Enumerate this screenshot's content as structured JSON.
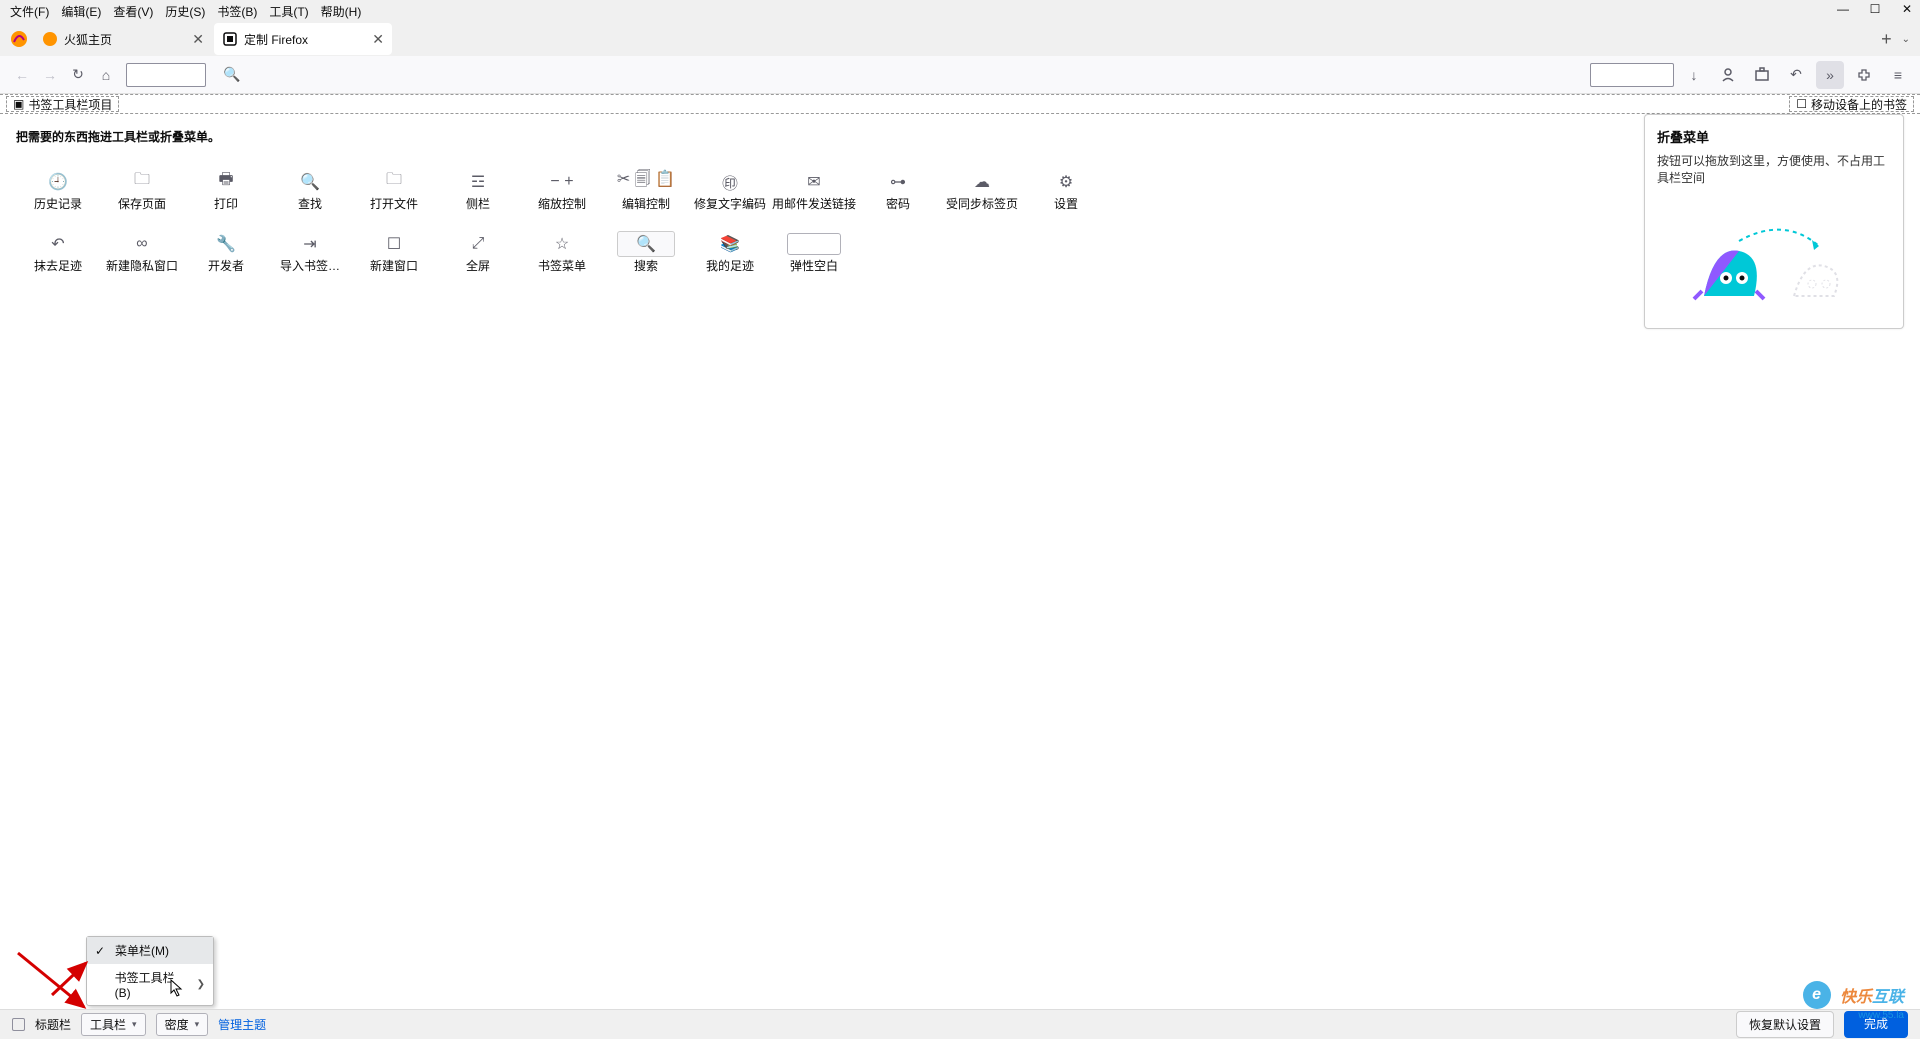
{
  "menu": {
    "file": "文件(F)",
    "edit": "编辑(E)",
    "view": "查看(V)",
    "history": "历史(S)",
    "bookmarks": "书签(B)",
    "tools": "工具(T)",
    "help": "帮助(H)"
  },
  "win": {
    "min": "—",
    "max": "☐",
    "close": "✕"
  },
  "tabs": {
    "t1": {
      "title": "火狐主页"
    },
    "t2": {
      "title": "定制 Firefox"
    },
    "plus": "+",
    "caret": "⌄"
  },
  "nav": {
    "back": "←",
    "forward": "→",
    "reload": "↻",
    "home": "⌂",
    "download": "↓",
    "account": "◯",
    "screenshot": "⧉",
    "forget": "↶",
    "more": "»",
    "ext": "✧",
    "hamburger": "≡"
  },
  "bm": {
    "left_icon": "▣",
    "left": "书签工具栏项目",
    "right_icon": "☐",
    "right": "移动设备上的书签"
  },
  "customize": {
    "instruction": "把需要的东西拖进工具栏或折叠菜单。",
    "tools": [
      {
        "label": "历史记录",
        "icon": "🕘"
      },
      {
        "label": "保存页面",
        "icon": "🗀"
      },
      {
        "label": "打印",
        "icon": "🖶"
      },
      {
        "label": "查找",
        "icon": "🔍"
      },
      {
        "label": "打开文件",
        "icon": "🗀"
      },
      {
        "label": "侧栏",
        "icon": "☲"
      },
      {
        "label": "缩放控制",
        "icon": "− +"
      },
      {
        "label": "编辑控制",
        "icon": "✂ 🗐 📋"
      },
      {
        "label": "修复文字编码",
        "icon": "㊞"
      },
      {
        "label": "用邮件发送链接",
        "icon": "✉"
      },
      {
        "label": "密码",
        "icon": "⊶"
      },
      {
        "label": "受同步标签页",
        "icon": "☁"
      },
      {
        "label": "设置",
        "icon": "⚙"
      },
      {
        "label": "抹去足迹",
        "icon": "↶"
      },
      {
        "label": "新建隐私窗口",
        "icon": "∞"
      },
      {
        "label": "开发者",
        "icon": "🔧"
      },
      {
        "label": "导入书签…",
        "icon": "⇥"
      },
      {
        "label": "新建窗口",
        "icon": "☐"
      },
      {
        "label": "全屏",
        "icon": "⤢"
      },
      {
        "label": "书签菜单",
        "icon": "☆"
      },
      {
        "label": "搜索",
        "icon": "🔍",
        "boxed": true
      },
      {
        "label": "我的足迹",
        "icon": "📚"
      },
      {
        "label": "弹性空白",
        "icon": "",
        "spacer": true
      }
    ],
    "overflow": {
      "title": "折叠菜单",
      "desc": "按钮可以拖放到这里，方便使用、不占用工具栏空间"
    }
  },
  "bottom": {
    "titlebar": "标题栏",
    "toolbars": "工具栏",
    "density": "密度",
    "themes": "管理主题",
    "restore": "恢复默认设置",
    "done": "完成"
  },
  "popup": {
    "menubar": "菜单栏(M)",
    "bookmarks": "书签工具栏(B)"
  },
  "watermark": {
    "main_a": "快乐",
    "main_b": "互联",
    "sub": "www.55.la"
  }
}
